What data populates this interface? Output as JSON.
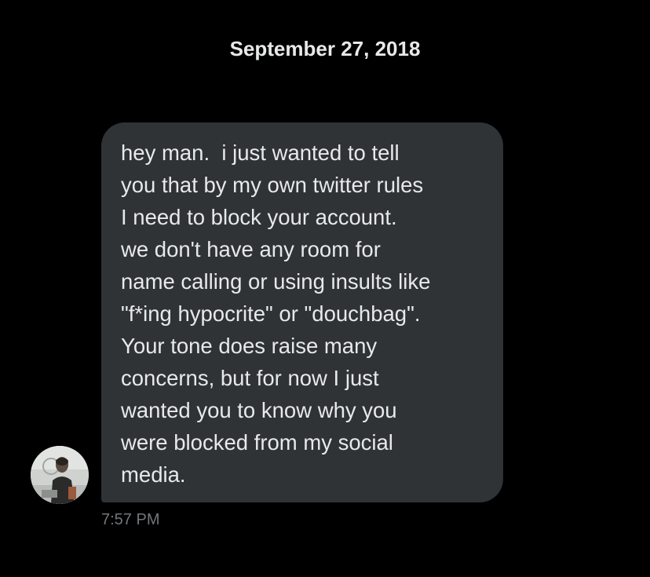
{
  "conversation": {
    "date_divider": "September 27, 2018",
    "messages": [
      {
        "text": "hey man.  i just wanted to tell\nyou that by my own twitter rules\nI need to block your account.\nwe don't have any room for\nname calling or using insults like\n\"f*ing hypocrite\" or \"douchbag\".\nYour tone does raise many\nconcerns, but for now I just\nwanted you to know why you\nwere blocked from my social\nmedia.",
        "timestamp": "7:57 PM"
      }
    ]
  },
  "colors": {
    "background": "#000000",
    "bubble": "#2f3336",
    "text": "#e7e9ea",
    "timestamp": "#71767b"
  },
  "icons": {
    "avatar": "user-avatar-photo"
  }
}
